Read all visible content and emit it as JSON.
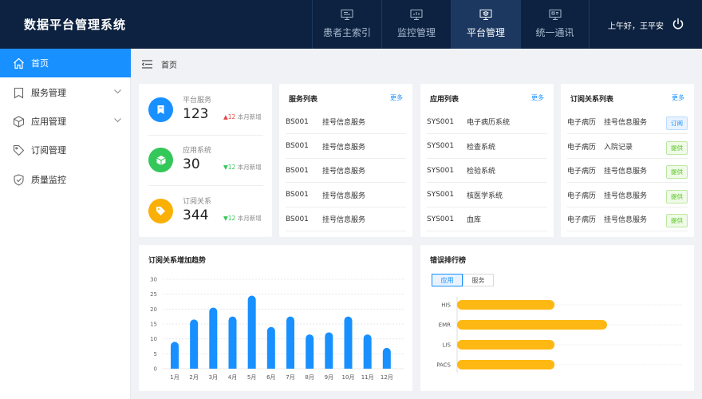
{
  "header": {
    "app_title": "数据平台管理系统",
    "nav": [
      {
        "label": "患者主索引",
        "icon": "monitor-icon"
      },
      {
        "label": "监控管理",
        "icon": "monitor-chart-icon"
      },
      {
        "label": "平台管理",
        "icon": "layers-icon",
        "active": true
      },
      {
        "label": "统一通讯",
        "icon": "monitor-list-icon"
      }
    ],
    "user_greeting": "上午好，王平安"
  },
  "sidebar": {
    "items": [
      {
        "label": "首页",
        "icon": "home-icon",
        "active": true
      },
      {
        "label": "服务管理",
        "icon": "bookmark-icon",
        "expandable": true
      },
      {
        "label": "应用管理",
        "icon": "cube-icon",
        "expandable": true
      },
      {
        "label": "订阅管理",
        "icon": "tag-icon"
      },
      {
        "label": "质量监控",
        "icon": "shield-icon"
      }
    ]
  },
  "breadcrumb": {
    "label": "首页"
  },
  "stats": [
    {
      "label": "平台服务",
      "value": "123",
      "change": "12",
      "direction": "up",
      "note": "本月新增",
      "color": "#1890ff"
    },
    {
      "label": "应用系统",
      "value": "30",
      "change": "12",
      "direction": "down",
      "note": "本月新增",
      "color": "#34c759"
    },
    {
      "label": "订阅关系",
      "value": "344",
      "change": "12",
      "direction": "down",
      "note": "本月新增",
      "color": "#fab005"
    }
  ],
  "service_list": {
    "title": "服务列表",
    "more": "更多",
    "rows": [
      {
        "code": "BS001",
        "name": "挂号信息服务"
      },
      {
        "code": "BS001",
        "name": "挂号信息服务"
      },
      {
        "code": "BS001",
        "name": "挂号信息服务"
      },
      {
        "code": "BS001",
        "name": "挂号信息服务"
      },
      {
        "code": "BS001",
        "name": "挂号信息服务"
      }
    ]
  },
  "app_list": {
    "title": "应用列表",
    "more": "更多",
    "rows": [
      {
        "code": "SYS001",
        "name": "电子病历系统"
      },
      {
        "code": "SYS001",
        "name": "检查系统"
      },
      {
        "code": "SYS001",
        "name": "检验系统"
      },
      {
        "code": "SYS001",
        "name": "核医学系统"
      },
      {
        "code": "SYS001",
        "name": "血库"
      }
    ]
  },
  "subscription_list": {
    "title": "订阅关系列表",
    "more": "更多",
    "rows": [
      {
        "source": "电子病历",
        "service": "挂号信息服务",
        "tag": "订阅",
        "tag_type": "blue"
      },
      {
        "source": "电子病历",
        "service": "入院记录",
        "tag": "提供",
        "tag_type": "green"
      },
      {
        "source": "电子病历",
        "service": "挂号信息服务",
        "tag": "提供",
        "tag_type": "green"
      },
      {
        "source": "电子病历",
        "service": "挂号信息服务",
        "tag": "提供",
        "tag_type": "green"
      },
      {
        "source": "电子病历",
        "service": "挂号信息服务",
        "tag": "提供",
        "tag_type": "green"
      }
    ]
  },
  "colors": {
    "accent": "#1890ff",
    "bar": "#fdb813",
    "header_bg": "#0d2240"
  },
  "chart_data": [
    {
      "type": "bar",
      "title": "订阅关系增加趋势",
      "categories": [
        "1月",
        "2月",
        "3月",
        "4月",
        "5月",
        "6月",
        "7月",
        "8月",
        "9月",
        "10月",
        "11月",
        "12月"
      ],
      "values": [
        9,
        16.5,
        20.5,
        17.5,
        24.5,
        14,
        17.5,
        11.5,
        12.2,
        17.5,
        11.5,
        7
      ],
      "ylim": [
        0,
        30
      ],
      "yticks": [
        0,
        5,
        10,
        15,
        20,
        25,
        30
      ],
      "grid": true,
      "color": "#1890ff"
    },
    {
      "type": "bar",
      "orientation": "horizontal",
      "title": "错误排行榜",
      "tabs": [
        {
          "label": "应用",
          "active": true
        },
        {
          "label": "服务",
          "active": false
        }
      ],
      "categories": [
        "HIS",
        "EMR",
        "LIS",
        "PACS"
      ],
      "values": [
        65,
        100,
        65,
        65
      ],
      "xlim": [
        0,
        150
      ],
      "grid": true,
      "color": "#fdb813"
    }
  ]
}
